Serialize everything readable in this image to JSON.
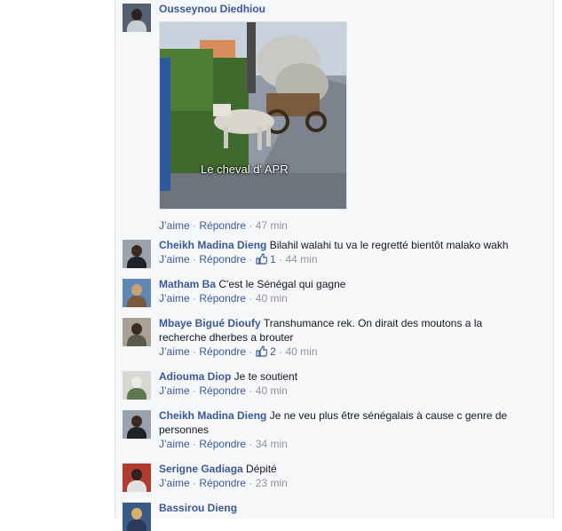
{
  "comments": [
    {
      "author": "Ousseynou Diedhiou",
      "text": "",
      "photo_caption": "Le cheval d' APR",
      "actions": {
        "like": "J’aime",
        "sep": "·",
        "reply": "Répondre",
        "time": "47 min"
      },
      "avatar_icon": "person-avatar-icon"
    },
    {
      "author": "Cheikh Madina Dieng",
      "text": "Bilahil walahi tu va le regretté bientôt malako wakh",
      "actions": {
        "like": "J’aime",
        "sep": "·",
        "reply": "Répondre",
        "likes_count": "1",
        "time": "44 min"
      }
    },
    {
      "author": "Matham Ba",
      "text": "C'est le Sénégal qui gagne",
      "actions": {
        "like": "J’aime",
        "sep": "·",
        "reply": "Répondre",
        "time": "40 min"
      }
    },
    {
      "author": "Mbaye Bigué Dioufy",
      "text": "Transhumance rek. On dirait des moutons a la recherche dherbes a brouter",
      "actions": {
        "like": "J’aime",
        "sep": "·",
        "reply": "Répondre",
        "likes_count": "2",
        "time": "40 min"
      }
    },
    {
      "author": "Adiouma Diop",
      "text": "Je te soutient",
      "actions": {
        "like": "J’aime",
        "sep": "·",
        "reply": "Répondre",
        "time": "40 min"
      }
    },
    {
      "author": "Cheikh Madina Dieng",
      "text": "Je ne veu plus être sénégalais à cause c genre de personnes",
      "actions": {
        "like": "J’aime",
        "sep": "·",
        "reply": "Répondre",
        "time": "34 min"
      }
    },
    {
      "author": "Serigne Gadiaga",
      "text": "Dépité",
      "actions": {
        "like": "J’aime",
        "sep": "·",
        "reply": "Répondre",
        "time": "23 min"
      }
    },
    {
      "author": "Bassirou Dieng",
      "text": ""
    }
  ],
  "colors": {
    "link": "#3b5998",
    "meta": "#90949c",
    "panel_bg": "#f6f7f9"
  }
}
